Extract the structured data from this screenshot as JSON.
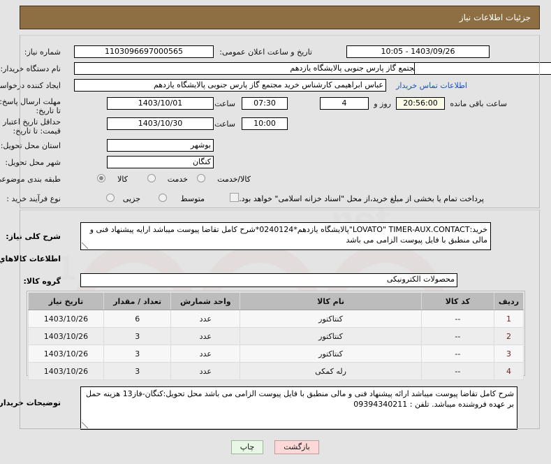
{
  "header": {
    "title": "جزئیات اطلاعات نیاز"
  },
  "form": {
    "need_number": {
      "label": "شماره نیاز:",
      "value": "1103096697000565"
    },
    "public_announce": {
      "label": "تاریخ و ساعت اعلان عمومی:",
      "value": "1403/09/26 - 10:05"
    },
    "buyer_org": {
      "label": "نام دستگاه خریدار:",
      "value": "مجتمع گاز پارس جنوبی  پالایشگاه یازدهم"
    },
    "buyer_org_second": {
      "value": ""
    },
    "requester": {
      "label": "ایجاد کننده درخواست:",
      "value": "عباس ابراهیمی کارشناس خرید مجتمع گاز پارس جنوبی  پالایشگاه یازدهم"
    },
    "contact_link": {
      "label": "اطلاعات تماس خریدار"
    },
    "response_deadline": {
      "label": "مهلت ارسال پاسخ: تا تاریخ:",
      "date": "1403/10/01",
      "time_label": "ساعت",
      "time": "07:30",
      "days": "4",
      "days_label": "روز و",
      "remaining": "20:56:00",
      "remaining_label": "ساعت باقی مانده"
    },
    "price_validity": {
      "label": "حداقل تاریخ اعتبار قیمت: تا تاریخ:",
      "date": "1403/10/30",
      "time_label": "ساعت",
      "time": "10:00"
    },
    "province": {
      "label": "استان محل تحویل:",
      "value": "بوشهر"
    },
    "city": {
      "label": "شهر محل تحویل:",
      "value": "کنگان"
    },
    "subject_class": {
      "label": "طبقه بندی موضوعی:",
      "options": [
        "کالا",
        "خدمت",
        "کالا/خدمت"
      ],
      "selected": "کالا"
    },
    "purchase_process": {
      "label": "نوع فرآیند خرید :",
      "options": [
        "جزیی",
        "متوسط"
      ],
      "selected": ""
    },
    "treasury_note": {
      "checked": false,
      "text": "پرداخت تمام یا بخشی از مبلغ خرید،از محل \"اسناد خزانه اسلامی\" خواهد بود."
    }
  },
  "summary": {
    "label": "شرح کلی نیاز:",
    "text": "خرید:LOVATO\" TIMER-AUX.CONTACT\"پالایشگاه یازدهم*0240124*شرح کامل تقاضا پیوست میباشد ارایه پیشنهاد فنی و مالی منطبق با فایل پیوست الزامی می باشد"
  },
  "goods_section": {
    "heading": "اطلاعات کالاهاي مورد نیاز",
    "group_label": "گروه کالا:",
    "group_value": "محصولات الکترونیکی",
    "columns": [
      "ردیف",
      "کد کالا",
      "نام کالا",
      "واحد شمارش",
      "تعداد / مقدار",
      "تاریخ نیاز"
    ],
    "rows": [
      {
        "idx": "1",
        "code": "--",
        "name": "کنتاکتور",
        "unit": "عدد",
        "qty": "6",
        "date": "1403/10/26"
      },
      {
        "idx": "2",
        "code": "--",
        "name": "کنتاکتور",
        "unit": "عدد",
        "qty": "3",
        "date": "1403/10/26"
      },
      {
        "idx": "3",
        "code": "--",
        "name": "کنتاکتور",
        "unit": "عدد",
        "qty": "3",
        "date": "1403/10/26"
      },
      {
        "idx": "4",
        "code": "--",
        "name": "رله کمکی",
        "unit": "عدد",
        "qty": "3",
        "date": "1403/10/26"
      }
    ]
  },
  "buyer_notes": {
    "label": "توضیحات خریدار:",
    "text": "شرح کامل تقاضا پیوست میباشد ارائه پیشنهاد فنی و مالی منطبق با فایل پیوست الزامی می باشد محل تحویل:کنگان-فاز13 هزینه حمل بر عهده فروشنده میباشد. تلفن : 09394340211"
  },
  "footer": {
    "print_label": "چاپ",
    "back_label": "بازگشت"
  },
  "colors": {
    "titlebar": "#8e6f44",
    "link": "#1850c8",
    "print_bg": "#e9f7e6",
    "back_bg": "#fbd9d9",
    "table_header_bg": "#bcbcbc"
  }
}
